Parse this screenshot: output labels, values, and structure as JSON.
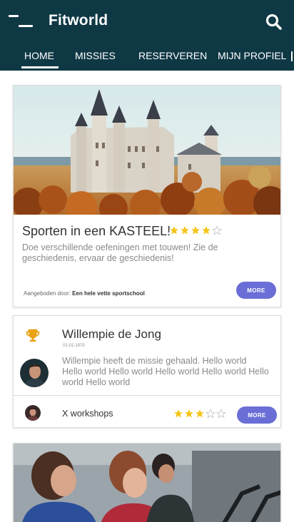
{
  "app": {
    "title": "Fitworld"
  },
  "tabs": [
    {
      "label": "HOME",
      "active": true
    },
    {
      "label": "MISSIES",
      "active": false
    },
    {
      "label": "RESERVEREN",
      "active": false
    },
    {
      "label": "MIJN PROFIEL",
      "active": false
    }
  ],
  "mission_card": {
    "title": "Sporten in een KASTEEL!",
    "rating": 4,
    "rating_max": 5,
    "description": "Doe verschillende oefeningen met touwen! Zie de geschiedenis, ervaar de geschiedenis!",
    "offered_by_label": "Aangeboden door:",
    "offered_by_name": "Een hele vette sportschool",
    "more_label": "MORE"
  },
  "achievement_card": {
    "icon": "trophy-icon",
    "user_name": "Willempie de Jong",
    "date": "01-01-1970",
    "message": "Willempie heeft de missie gehaald. Hello world Hello world Hello world  Hello world Hello world Hello world Hello world",
    "activity": "X workshops",
    "rating": 3,
    "rating_max": 5,
    "more_label": "MORE"
  },
  "colors": {
    "header_bg": "#0f3845",
    "accent_button": "#6a6ed6",
    "star_filled": "#f5c518",
    "star_empty": "#c8c8c8",
    "trophy": "#e8a317"
  }
}
